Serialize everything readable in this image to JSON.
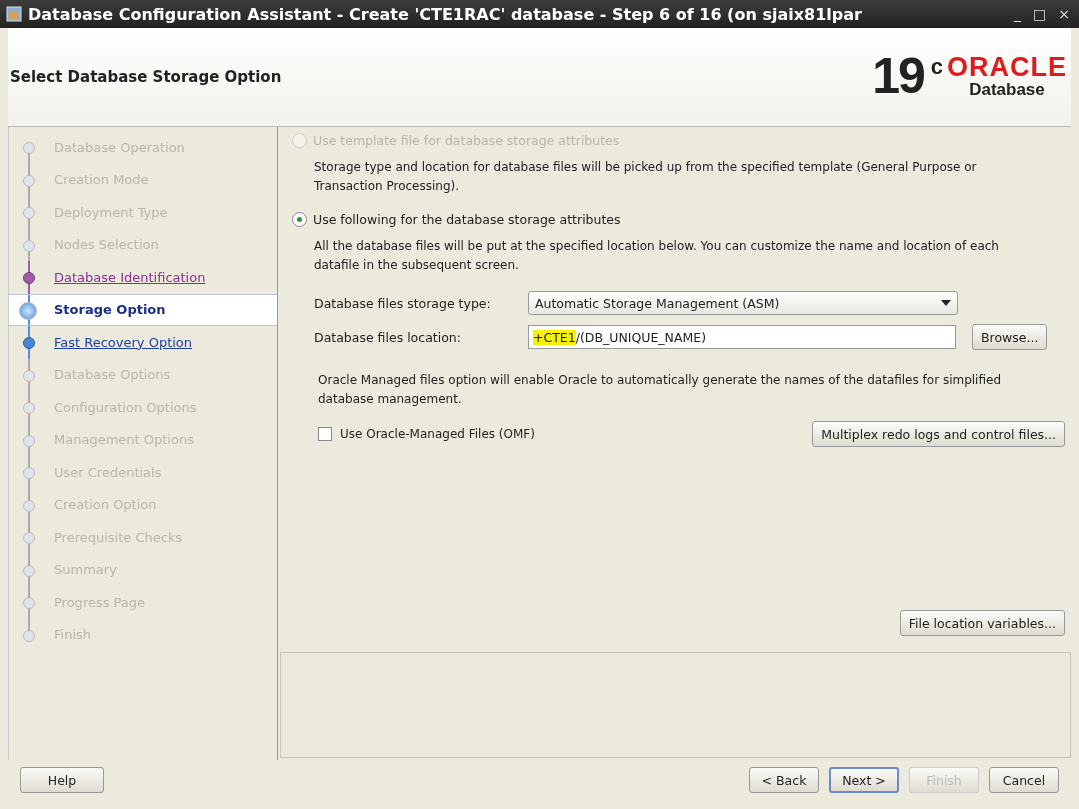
{
  "window": {
    "title": "Database Configuration Assistant - Create 'CTE1RAC' database - Step 6 of 16 (on sjaix81lpar",
    "controls": [
      "_",
      "□",
      "×"
    ]
  },
  "header": {
    "title": "Select Database Storage Option",
    "logo_version": "19",
    "logo_sup": "c",
    "logo_brand": "ORACLE",
    "logo_product": "Database"
  },
  "steps": [
    {
      "label": "Database Operation",
      "kind": "disabled",
      "selected": false
    },
    {
      "label": "Creation Mode",
      "kind": "disabled",
      "selected": false
    },
    {
      "label": "Deployment Type",
      "kind": "disabled",
      "selected": false
    },
    {
      "label": "Nodes Selection",
      "kind": "disabled",
      "selected": false
    },
    {
      "label": "Database Identification",
      "kind": "visited",
      "selected": false
    },
    {
      "label": "Storage Option",
      "kind": "current",
      "selected": true
    },
    {
      "label": "Fast Recovery Option",
      "kind": "available",
      "selected": false
    },
    {
      "label": "Database Options",
      "kind": "disabled",
      "selected": false
    },
    {
      "label": "Configuration Options",
      "kind": "disabled",
      "selected": false
    },
    {
      "label": "Management Options",
      "kind": "disabled",
      "selected": false
    },
    {
      "label": "User Credentials",
      "kind": "disabled",
      "selected": false
    },
    {
      "label": "Creation Option",
      "kind": "disabled",
      "selected": false
    },
    {
      "label": "Prerequisite Checks",
      "kind": "disabled",
      "selected": false
    },
    {
      "label": "Summary",
      "kind": "disabled",
      "selected": false
    },
    {
      "label": "Progress Page",
      "kind": "disabled",
      "selected": false
    },
    {
      "label": "Finish",
      "kind": "disabled",
      "selected": false
    }
  ],
  "options": [
    {
      "label": "Use template file for database storage attributes",
      "selected": false,
      "disabled": true,
      "description": "Storage type and location for database files will be picked up from the specified template (General Purpose or Transaction Processing)."
    },
    {
      "label": "Use following for the database storage attributes",
      "selected": true,
      "disabled": false,
      "description": "All the database files will be put at the specified location below. You can customize the name and location of each datafile in the subsequent screen."
    }
  ],
  "storage_type": {
    "label": "Database files storage type:",
    "value": "Automatic Storage Management (ASM)"
  },
  "location": {
    "label": "Database files location:",
    "value_parts": [
      {
        "text": "+CTE1",
        "highlighted": true
      },
      {
        "text": "/(DB_UNIQUE_NAME)",
        "highlighted": false
      }
    ],
    "button": "Browse..."
  },
  "omf_note": "Oracle Managed files option will enable Oracle to automatically generate the names of the datafiles for simplified database management.",
  "omf_checkbox": {
    "label": "Use Oracle-Managed Files (OMF)",
    "checked": false
  },
  "multiplex_button": "Multiplex redo logs and control files...",
  "file_location_button": "File location variables...",
  "buttons": [
    {
      "label": "Help",
      "disabled": false,
      "default": false
    },
    {
      "label": "< Back",
      "disabled": false,
      "default": false
    },
    {
      "label": "Next >",
      "disabled": false,
      "default": true
    },
    {
      "label": "Finish",
      "disabled": true,
      "default": false
    },
    {
      "label": "Cancel",
      "disabled": false,
      "default": false
    }
  ]
}
